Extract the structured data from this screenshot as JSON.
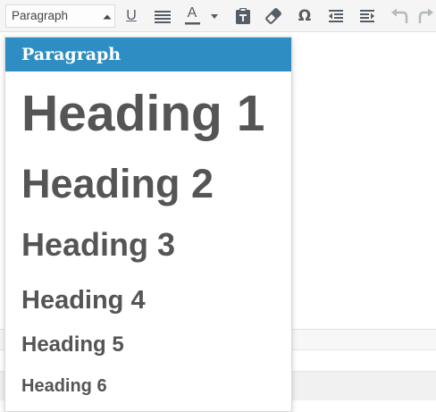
{
  "toolbar": {
    "format_select_value": "Paragraph",
    "buttons": [
      {
        "name": "underline",
        "icon": "underline-icon"
      },
      {
        "name": "justify",
        "icon": "align-justify-icon"
      },
      {
        "name": "text-color",
        "icon": "text-color-icon"
      },
      {
        "name": "paste-as-text",
        "icon": "clipboard-icon"
      },
      {
        "name": "clear-formatting",
        "icon": "eraser-icon"
      },
      {
        "name": "special-character",
        "icon": "omega-icon"
      },
      {
        "name": "outdent",
        "icon": "outdent-icon"
      },
      {
        "name": "indent",
        "icon": "indent-icon"
      },
      {
        "name": "undo",
        "icon": "undo-icon"
      },
      {
        "name": "redo",
        "icon": "redo-icon"
      }
    ],
    "underline_glyph": "U",
    "text_color_glyph": "A",
    "omega_glyph": "Ω"
  },
  "format_menu": {
    "items": [
      {
        "label": "Paragraph",
        "selected": true
      },
      {
        "label": "Heading 1",
        "selected": false
      },
      {
        "label": "Heading 2",
        "selected": false
      },
      {
        "label": "Heading 3",
        "selected": false
      },
      {
        "label": "Heading 4",
        "selected": false
      },
      {
        "label": "Heading 5",
        "selected": false
      },
      {
        "label": "Heading 6",
        "selected": false
      }
    ]
  },
  "colors": {
    "accent": "#2e8ec3",
    "icon": "#555d66",
    "heading_text": "#555555",
    "disabled_icon": "#b4b9be"
  }
}
